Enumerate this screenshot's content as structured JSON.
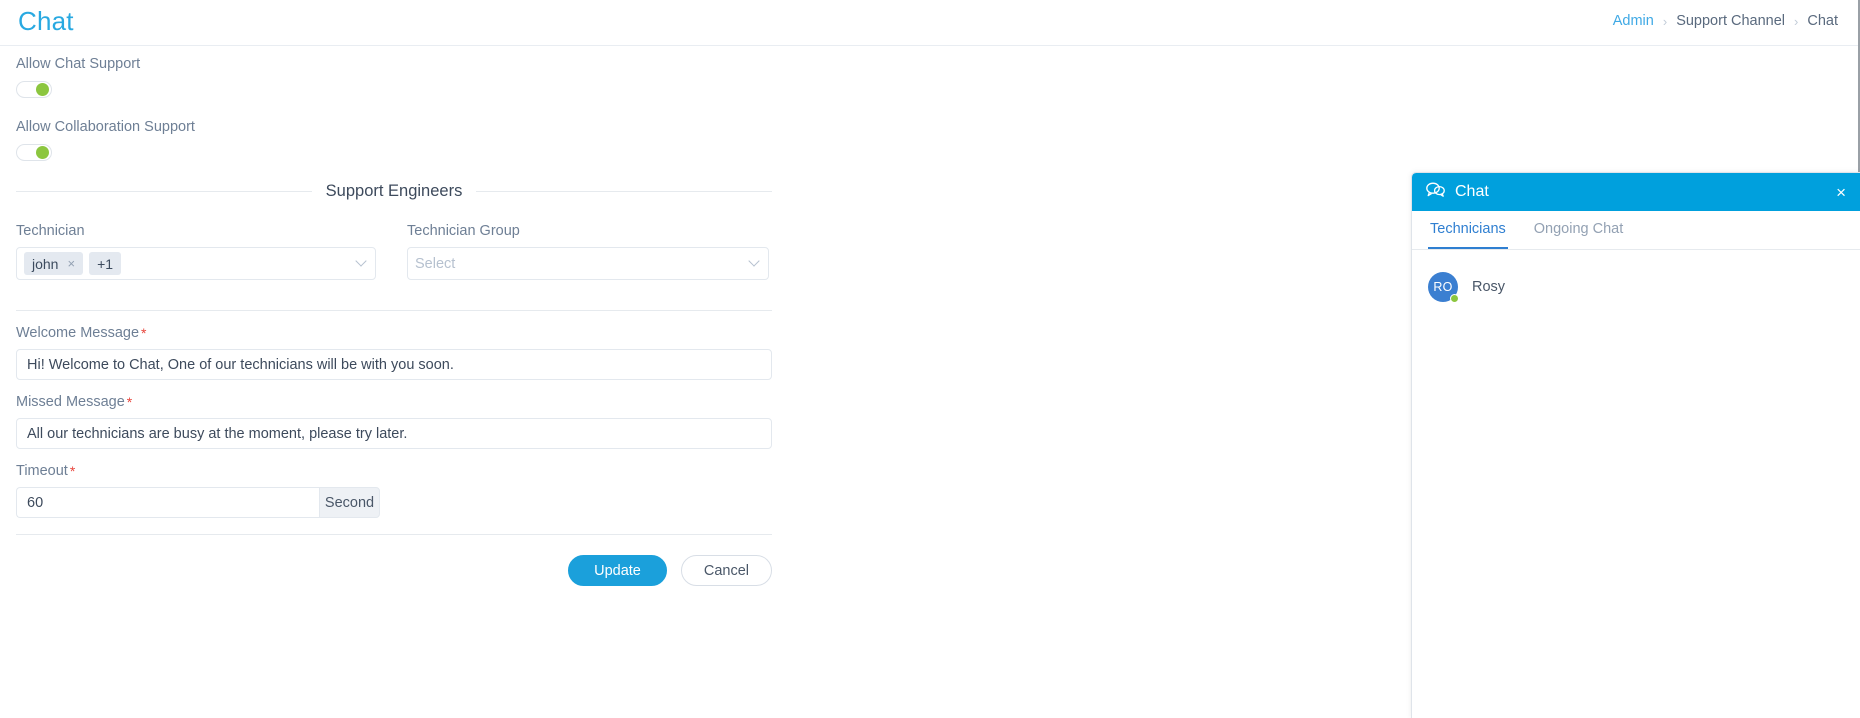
{
  "header": {
    "title": "Chat",
    "breadcrumb": [
      {
        "label": "Admin",
        "type": "link"
      },
      {
        "label": "Support Channel",
        "type": "plain"
      },
      {
        "label": "Chat",
        "type": "plain"
      }
    ],
    "separator": "›"
  },
  "settings": {
    "chat_support_label": "Allow Chat Support",
    "chat_support_state": "on",
    "collaboration_label": "Allow Collaboration Support",
    "collaboration_state": "on"
  },
  "support_engineers": {
    "section_title": "Support Engineers",
    "technician": {
      "label": "Technician",
      "chips": [
        {
          "text": "john",
          "removable": true,
          "remove_glyph": "×"
        },
        {
          "text": "+1",
          "removable": false
        }
      ]
    },
    "technician_group": {
      "label": "Technician Group",
      "placeholder": "Select",
      "value": ""
    }
  },
  "messages": {
    "welcome": {
      "label": "Welcome Message",
      "required_marker": "*",
      "value": "Hi! Welcome to Chat, One of our technicians will be with you soon.",
      "placeholder": ""
    },
    "missed": {
      "label": "Missed Message",
      "required_marker": "*",
      "value": "All our technicians are busy at the moment, please try later.",
      "placeholder": ""
    },
    "timeout": {
      "label": "Timeout",
      "required_marker": "*",
      "value": "60",
      "unit": "Second",
      "placeholder": ""
    }
  },
  "actions": {
    "update_label": "Update",
    "cancel_label": "Cancel"
  },
  "chat_widget": {
    "title": "Chat",
    "close_glyph": "×",
    "tabs": [
      {
        "label": "Technicians",
        "active": true
      },
      {
        "label": "Ongoing Chat",
        "active": false
      }
    ],
    "technicians": [
      {
        "initials": "RO",
        "name": "Rosy",
        "status": "online"
      }
    ]
  },
  "colors": {
    "accent_blue": "#29a9e1",
    "header_blue": "#00a0dd",
    "tab_blue": "#2f7fd1",
    "online_green": "#8cc63f",
    "required_red": "#e8453c",
    "avatar_blue": "#3b7fd1"
  }
}
